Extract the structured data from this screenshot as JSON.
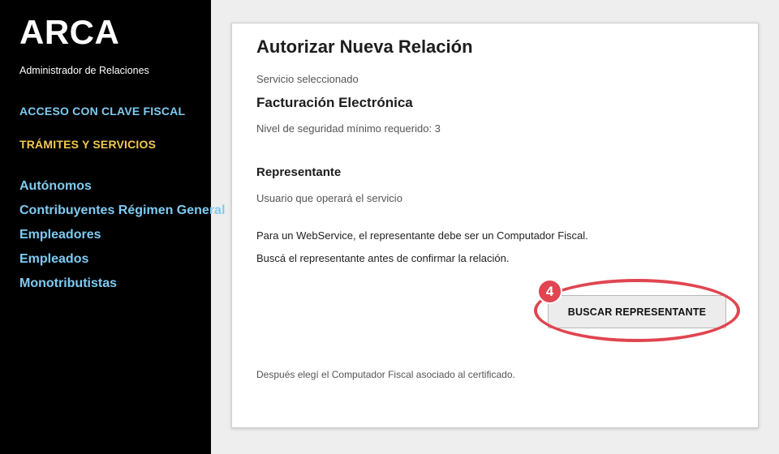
{
  "sidebar": {
    "brand": "ARCA",
    "subtitle": "Administrador de Relaciones",
    "section_clave": "ACCESO CON CLAVE FISCAL",
    "section_tramites": "TRÁMITES Y SERVICIOS",
    "items": [
      {
        "label": "Autónomos"
      },
      {
        "label": "Contribuyentes Régimen General"
      },
      {
        "label": "Empleadores"
      },
      {
        "label": "Empleados"
      },
      {
        "label": "Monotributistas"
      }
    ]
  },
  "card": {
    "title": "Autorizar Nueva Relación",
    "service_label": "Servicio seleccionado",
    "service_name": "Facturación Electrónica",
    "security_level": "Nivel de seguridad mínimo requerido: 3",
    "rep_heading": "Representante",
    "rep_user": "Usuario que operará el servicio",
    "ws_note": "Para un WebService, el representante debe ser un Computador Fiscal.",
    "search_hint": "Buscá el representante antes de confirmar la relación.",
    "search_button": "BUSCAR REPRESENTANTE",
    "footnote": "Después elegí el Computador Fiscal asociado al certificado."
  },
  "annotation": {
    "step": "4",
    "color": "#e04550"
  },
  "colors": {
    "sidebar_bg": "#000000",
    "link_blue": "#7ecbf2",
    "section_yellow": "#f2c94c"
  }
}
